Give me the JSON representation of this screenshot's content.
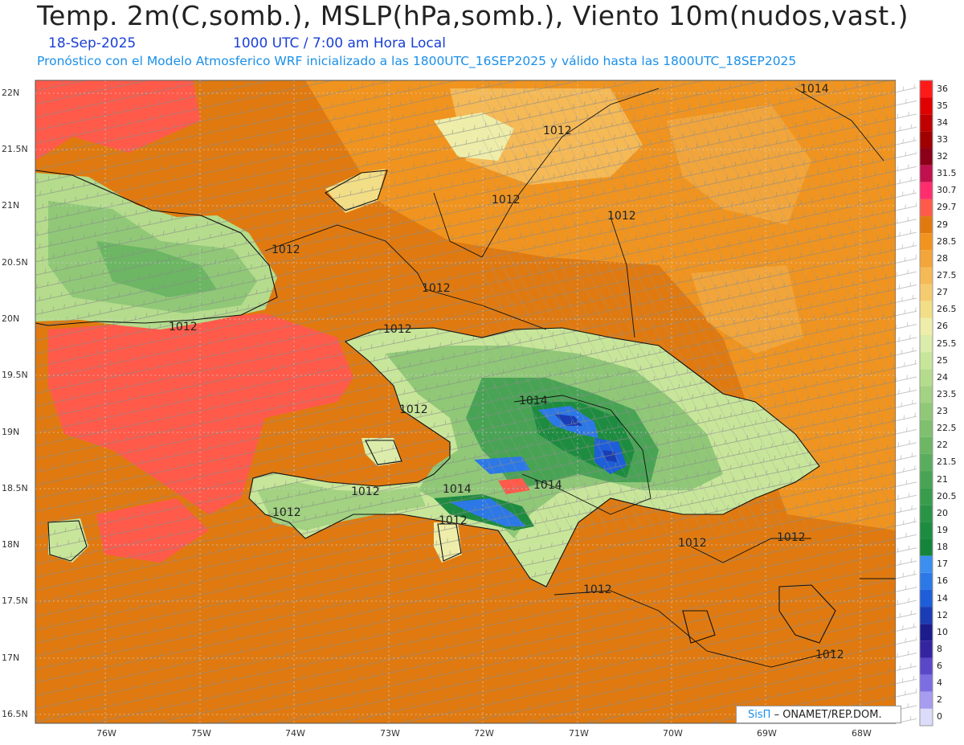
{
  "header": {
    "title": "Temp. 2m(C,somb.), MSLP(hPa,somb.), Viento 10m(nudos,vast.)",
    "date": "18-Sep-2025",
    "time": "1000 UTC / 7:00 am Hora Local",
    "model_info": "Pronóstico con el Modelo Atmosferico WRF inicializado a las 1800UTC_16SEP2025 y válido hasta las  1800UTC_18SEP2025"
  },
  "axes": {
    "lat_labels": [
      "22N",
      "21.5N",
      "21N",
      "20.5N",
      "20N",
      "19.5N",
      "19N",
      "18.5N",
      "18N",
      "17.5N",
      "17N",
      "16.5N"
    ],
    "lon_labels": [
      "76W",
      "75W",
      "74W",
      "73W",
      "72W",
      "71W",
      "70W",
      "69W",
      "68W"
    ]
  },
  "colorbar": {
    "levels": [
      "36",
      "35",
      "34",
      "33",
      "32",
      "31.5",
      "30.7",
      "29.7",
      "29",
      "28.5",
      "28",
      "27.5",
      "27",
      "26.5",
      "26",
      "25.5",
      "25",
      "24",
      "23.5",
      "23",
      "22.5",
      "22",
      "21.5",
      "21",
      "20.5",
      "20",
      "19",
      "18",
      "17",
      "16",
      "14",
      "12",
      "10",
      "8",
      "6",
      "4",
      "2",
      "0"
    ],
    "colors": [
      "#ff1a1a",
      "#e00000",
      "#c00000",
      "#a00000",
      "#8b0018",
      "#c0104e",
      "#ff2d6e",
      "#ff5a4a",
      "#e07a10",
      "#f0941f",
      "#f2a53a",
      "#f5b956",
      "#f5cb70",
      "#f2de86",
      "#eeeeaa",
      "#dcecaa",
      "#c8e69a",
      "#b4dc8c",
      "#a2d282",
      "#90c878",
      "#7ec06e",
      "#6cb664",
      "#5aad5c",
      "#48a454",
      "#389c4c",
      "#2a9446",
      "#1e8c40",
      "#14843a",
      "#3c8ef0",
      "#2c78e6",
      "#1e5ed8",
      "#1a3cb4",
      "#1c1c8c",
      "#3424a0",
      "#5a48c8",
      "#7c6ee0",
      "#a89cf0",
      "#dcdcfa"
    ]
  },
  "map": {
    "pressure_labels": [
      "1014",
      "1012",
      "1012",
      "1012",
      "1012",
      "1012",
      "1012",
      "1012",
      "1014",
      "1012",
      "1014",
      "1012",
      "1012",
      "1014",
      "1012",
      "1012",
      "1012",
      "1012",
      "1012"
    ],
    "credit_brand": "SisΠ",
    "credit_text": "– ONAMET/REP.DOM."
  }
}
